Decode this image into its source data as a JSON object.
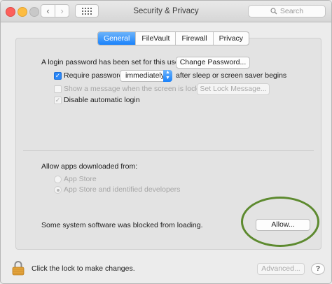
{
  "window": {
    "title": "Security & Privacy",
    "search_placeholder": "Search"
  },
  "tabs": [
    {
      "label": "General",
      "active": true
    },
    {
      "label": "FileVault",
      "active": false
    },
    {
      "label": "Firewall",
      "active": false
    },
    {
      "label": "Privacy",
      "active": false
    }
  ],
  "general": {
    "password_text": "A login password has been set for this user",
    "change_password_label": "Change Password...",
    "require_password_label": "Require password",
    "require_password_checked": true,
    "require_password_delay": "immediately",
    "require_password_suffix": "after sleep or screen saver begins",
    "show_message_label": "Show a message when the screen is locked",
    "set_lock_message_label": "Set Lock Message...",
    "disable_autologin_label": "Disable automatic login"
  },
  "downloads": {
    "heading": "Allow apps downloaded from:",
    "options": [
      {
        "label": "App Store",
        "selected": false
      },
      {
        "label": "App Store and identified developers",
        "selected": true
      }
    ]
  },
  "blocked": {
    "text": "Some system software was blocked from loading.",
    "allow_label": "Allow..."
  },
  "footer": {
    "lock_text": "Click the lock to make changes.",
    "advanced_label": "Advanced..."
  },
  "colors": {
    "accent": "#1a82fb",
    "highlight_circle": "#5d8a2f",
    "lock": "#e2a23b"
  }
}
